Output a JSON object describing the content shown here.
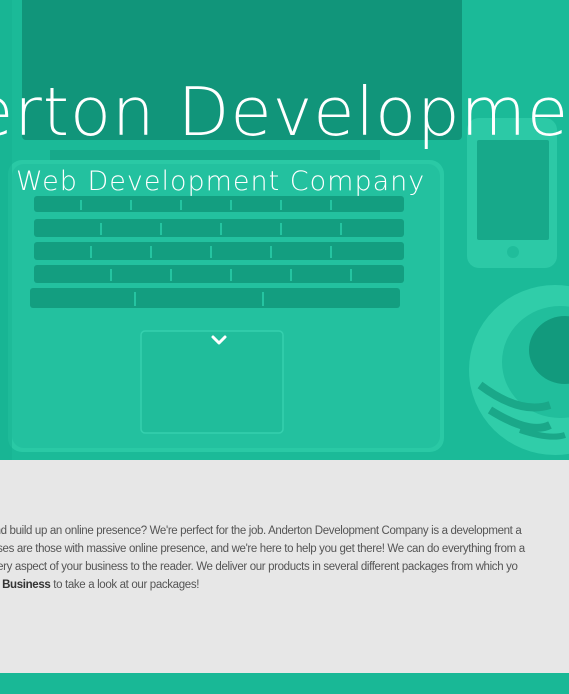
{
  "hero": {
    "title": "erton Developmen",
    "subtitle": "Web Development Company",
    "scroll_icon": "chevron-down-icon",
    "overlay_color": "#19b896"
  },
  "about": {
    "line1": "evel and build up an online presence? We're perfect for the job. Anderton Development Company is a development a",
    "line2": "usinesses are those with massive online presence, and we're here to help you get there! We can do everything from a",
    "line3": "eys every aspect of your business to the reader. We deliver our products in several different packages from which yo",
    "link_text": "d Your Business",
    "line4_rest": " to take a look at our packages!"
  },
  "colors": {
    "accent": "#19b896",
    "section_bg": "#e7e7e7",
    "body_text": "#555555"
  }
}
